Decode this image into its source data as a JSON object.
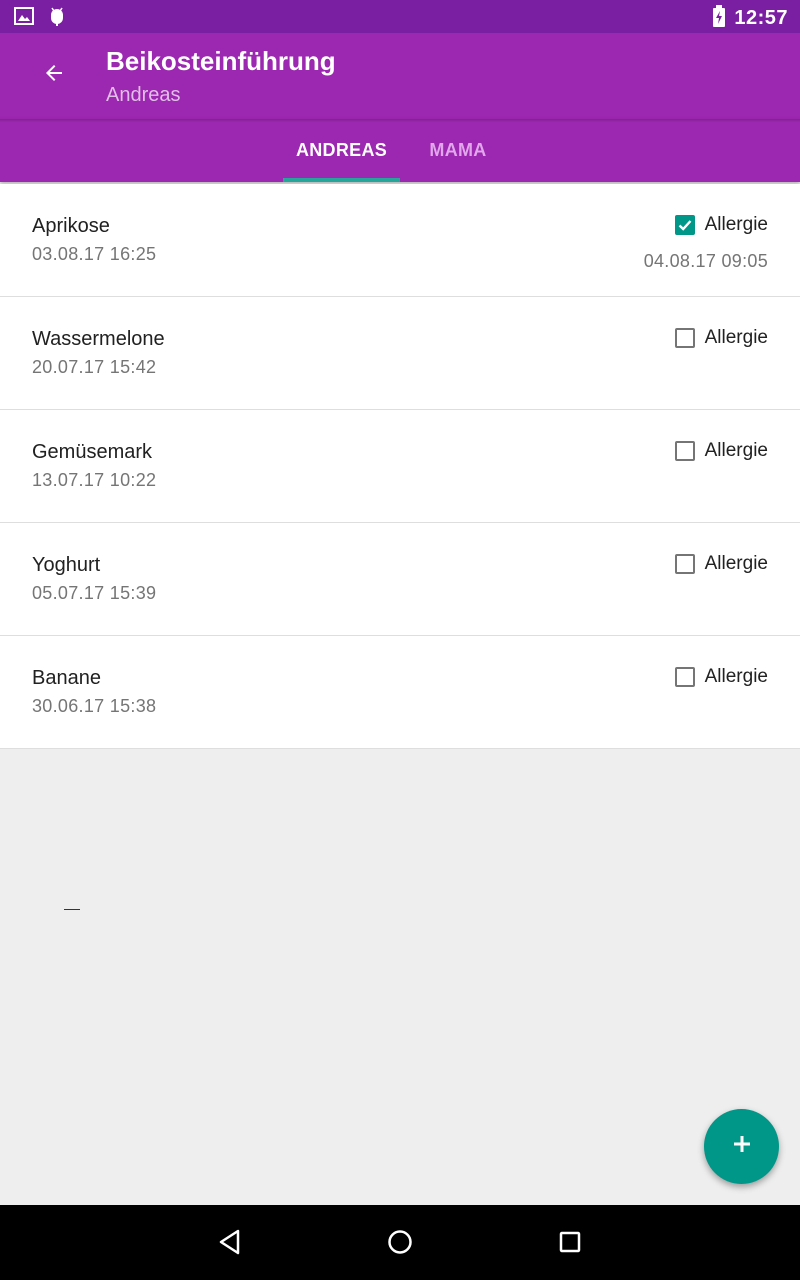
{
  "status_bar": {
    "time": "12:57",
    "left_icons": [
      "image-notification-icon",
      "android-debug-icon"
    ],
    "right_icons": [
      "battery-charging-icon"
    ]
  },
  "app_bar": {
    "title": "Beikosteinführung",
    "subtitle": "Andreas",
    "back_icon": "arrow-back-icon",
    "color": "#9c27b0",
    "status_color": "#7b1fa2"
  },
  "tabs": [
    {
      "label": "ANDREAS",
      "selected": true
    },
    {
      "label": "MAMA",
      "selected": false
    }
  ],
  "accent_color": "#009688",
  "foods": [
    {
      "name": "Aprikose",
      "date": "03.08.17  16:25",
      "allergy_label": "Allergie",
      "allergy_checked": true,
      "allergy_date": "04.08.17  09:05"
    },
    {
      "name": "Wassermelone",
      "date": "20.07.17  15:42",
      "allergy_label": "Allergie",
      "allergy_checked": false
    },
    {
      "name": "Gemüsemark",
      "date": "13.07.17  10:22",
      "allergy_label": "Allergie",
      "allergy_checked": false
    },
    {
      "name": "Yoghurt",
      "date": "05.07.17  15:39",
      "allergy_label": "Allergie",
      "allergy_checked": false
    },
    {
      "name": "Banane",
      "date": "30.06.17  15:38",
      "allergy_label": "Allergie",
      "allergy_checked": false
    }
  ],
  "fab": {
    "icon": "plus-icon"
  },
  "nav_bar": {
    "icons": [
      "back-triangle-icon",
      "home-circle-icon",
      "recents-square-icon"
    ]
  }
}
